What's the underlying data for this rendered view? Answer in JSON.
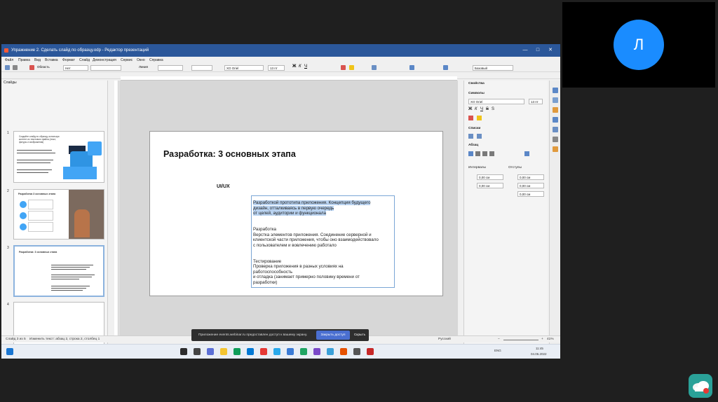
{
  "window": {
    "title": "Упражнение 2. Сделать слайд по образцу.odp - Редактор презентаций",
    "controls": [
      "—",
      "□",
      "✕"
    ]
  },
  "menu": [
    "Файл",
    "Правка",
    "Вид",
    "Вставка",
    "Формат",
    "Слайд",
    "Демонстрация",
    "Сервис",
    "Окно",
    "Справка"
  ],
  "toolbar": {
    "area_label": "Область",
    "fill_value": "Нет",
    "line_label": "Линия",
    "font_name": "XO Oriel",
    "font_size": "13 пт",
    "layout_value": "Базовый"
  },
  "slides_panel": {
    "header": "Слайды",
    "slides": [
      {
        "num": "1",
        "title": "Создайте слайд по образцу, используя контент из текстового файла (текст, фигуры и изображения)"
      },
      {
        "num": "2",
        "title": "Разработка 3 основных этапа"
      },
      {
        "num": "3",
        "title": "Разработка: 3 основных этапа"
      },
      {
        "num": "4",
        "title": ""
      },
      {
        "num": "5",
        "title": ""
      }
    ]
  },
  "slide": {
    "title": "Разработка: 3 основных этапа",
    "subtitle": "UI/UX",
    "text_lines": [
      {
        "text": "Разработкой прототипа приложения. Концепция будущего",
        "hl": true
      },
      {
        "text": "дизайн, отталкиваясь в первую очередь",
        "hl": true
      },
      {
        "text": "от целей, аудитории и функционала",
        "hl": true
      },
      {
        "text": "",
        "hl": false
      },
      {
        "text": "",
        "hl": false
      },
      {
        "text": "Разработка",
        "hl": false
      },
      {
        "text": "Верстка элементов приложения. Соединение серверной и",
        "hl": false
      },
      {
        "text": "клиентской части приложения, чтобы оно взаимодействовало",
        "hl": false
      },
      {
        "text": "с пользователем и вовлечению работало",
        "hl": false
      },
      {
        "text": "",
        "hl": false
      },
      {
        "text": "",
        "hl": false
      },
      {
        "text": "Тестирование",
        "hl": false
      },
      {
        "text": "Проверка приложения в разных условиях на",
        "hl": false
      },
      {
        "text": "работоспособность",
        "hl": false
      },
      {
        "text": "и отладка (занимает примерно половину времени от",
        "hl": false
      },
      {
        "text": "разработки)",
        "hl": false
      }
    ]
  },
  "sidebar": {
    "title": "Свойства",
    "char_section": "Символы",
    "font_name": "XO Oriel",
    "font_size": "13 пт",
    "lists_section": "Списки",
    "para_section": "Абзац",
    "spacing_label": "Интервалы",
    "indent_label": "Отступы",
    "spin_values": [
      "0,00 см",
      "0,00 см",
      "0,00 см",
      "0,00 см",
      "0,00 см"
    ]
  },
  "status": {
    "slide_info": "Слайд 3 из 5",
    "edit_info": "Изменить текст: абзац 2, строка 2, столбец 1",
    "language": "Русский",
    "zoom": "41%"
  },
  "share_bar": {
    "message": "Приложение events.webinar.ru предоставлен доступ к вашему экрану.",
    "stop_label": "Закрыть доступ",
    "hide_label": "Скрыть"
  },
  "taskbar": {
    "lang": "ENG",
    "time": "11:45",
    "date": "04.06.2022"
  },
  "video": {
    "avatar_letter": "Л"
  }
}
